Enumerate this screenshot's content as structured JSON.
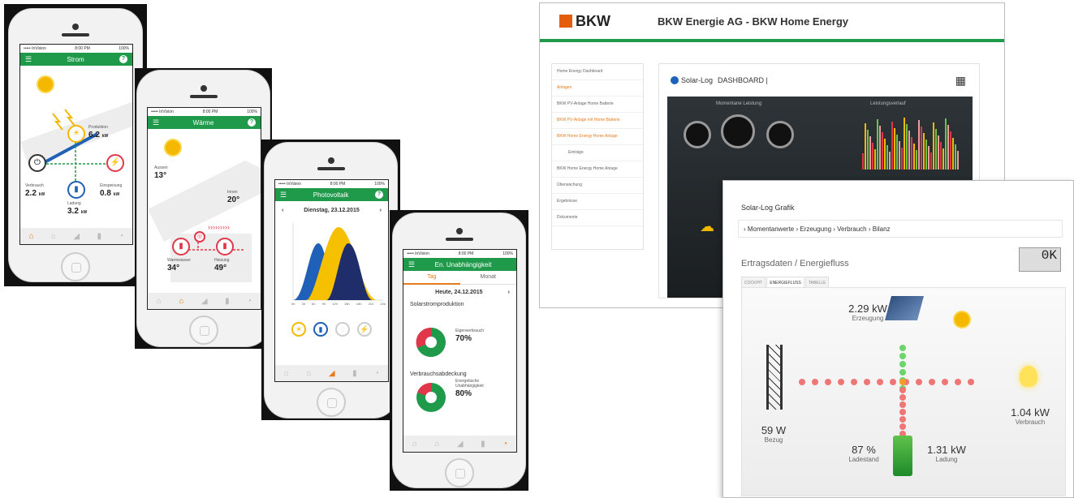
{
  "phone1": {
    "status_left": "••••• InVision",
    "status_time": "8:00 PM",
    "status_batt": "100%",
    "title": "Strom",
    "produktion_label": "Produktion",
    "produktion_value": "6.2",
    "produktion_unit": "kW",
    "verbrauch_label": "Verbrauch",
    "verbrauch_value": "2.2",
    "verbrauch_unit": "kW",
    "einspeisung_label": "Einspeisung",
    "einspeisung_value": "0.8",
    "einspeisung_unit": "kW",
    "ladung_label": "Ladung",
    "ladung_value": "3.2",
    "ladung_unit": "kW"
  },
  "phone2": {
    "status_left": "••••• InVision",
    "status_time": "8:00 PM",
    "status_batt": "100%",
    "title": "Wärme",
    "aussen_label": "Aussen",
    "aussen_value": "13°",
    "innen_label": "Innen",
    "innen_value": "20°",
    "warmwasser_label": "Warmwasser",
    "warmwasser_value": "34°",
    "heizung_label": "Heizung",
    "heizung_value": "49°"
  },
  "phone3": {
    "status_left": "••••• InVision",
    "status_time": "8:00 PM",
    "status_batt": "100%",
    "title": "Photovoltaik",
    "date": "Dienstag, 23.12.2015",
    "xticks": [
      "0h",
      "3h",
      "6h",
      "9h",
      "12h",
      "15h",
      "18h",
      "21h",
      "24h"
    ]
  },
  "phone4": {
    "status_left": "••••• InVision",
    "status_time": "8:00 PM",
    "status_batt": "100%",
    "title": "En. Unabhängigkeit",
    "tab_tag": "Tag",
    "tab_monat": "Monat",
    "date": "Heute, 24.12.2015",
    "solar_heading": "Solarstromproduktion",
    "eigen_label": "Eigenverbrauch",
    "eigen_value": "70%",
    "verbrauch_heading": "Verbrauchsabdeckung",
    "unab_label": "Energetische Unabhängigkeit",
    "unab_value": "80%"
  },
  "web1": {
    "logo": "BKW",
    "title": "BKW Energie AG - BKW Home Energy",
    "dashboard_label": "DASHBOARD |",
    "solarlog": "Solar-Log",
    "sidebar": [
      "Home Energy Dashboard",
      "Anlagen",
      "BKW PV-Anlage Home Batterie",
      "BKW PV-Anlage mit Home Batterie",
      "BKW Home Energy Home Anlage",
      "Einträge",
      "BKW Home Energy Home Anlage",
      "Überwachung",
      "Ergebnisse",
      "Dokumente"
    ],
    "panel_left": "Momentane Leistung",
    "panel_right": "Leistungsverlauf"
  },
  "web2": {
    "title": "Solar-Log Grafik",
    "crumb": "› Momentanwerte  › Erzeugung  › Verbrauch  › Bilanz",
    "section": "Ertragsdaten / Energiefluss",
    "tabs": [
      "COCKPIT",
      "ENERGIEFLUSS",
      "TABELLE"
    ],
    "lcd": "0K",
    "erzeugung_value": "2.29 kW",
    "erzeugung_label": "Erzeugung",
    "bezug_value": "59 W",
    "bezug_label": "Bezug",
    "verbrauch_value": "1.04 kW",
    "verbrauch_label": "Verbrauch",
    "ladestand_value": "87 %",
    "ladestand_label": "Ladestand",
    "ladung_value": "1.31 kW",
    "ladung_label": "Ladung"
  },
  "colors": {
    "green": "#1e9a4a",
    "orange": "#e57b1e",
    "red": "#e0384a",
    "yellow": "#f5b800",
    "navy": "#1f2d6b"
  }
}
